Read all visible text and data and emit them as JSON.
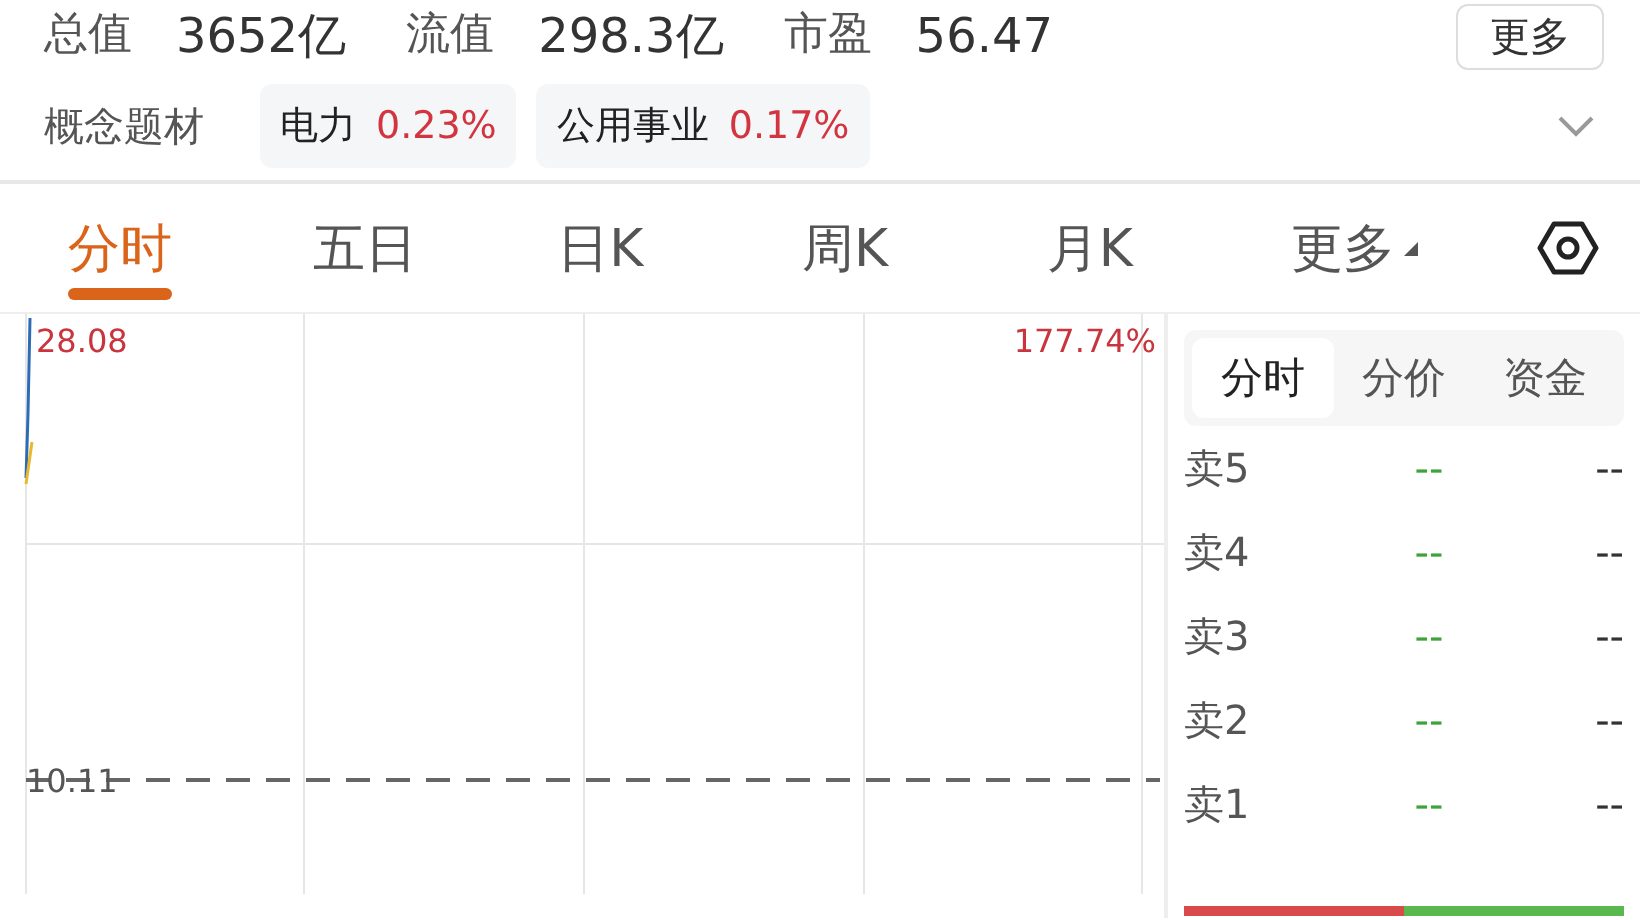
{
  "stats": [
    {
      "label": "总值",
      "value": "3652亿"
    },
    {
      "label": "流值",
      "value": "298.3亿"
    },
    {
      "label": "市盈",
      "value": "56.47"
    }
  ],
  "more_button": "更多",
  "concepts": {
    "label": "概念题材",
    "tags": [
      {
        "name": "电力",
        "change": "0.23%"
      },
      {
        "name": "公用事业",
        "change": "0.17%"
      }
    ]
  },
  "tabs": [
    {
      "label": "分时",
      "selected": true
    },
    {
      "label": "五日",
      "selected": false
    },
    {
      "label": "日K",
      "selected": false
    },
    {
      "label": "周K",
      "selected": false
    },
    {
      "label": "月K",
      "selected": false
    },
    {
      "label": "更多",
      "selected": false,
      "kind": "dropdown"
    }
  ],
  "chart": {
    "high_label": "28.08",
    "pct_label": "177.74%",
    "ref_label": "10.11"
  },
  "side_tabs": [
    {
      "label": "分时",
      "selected": true
    },
    {
      "label": "分价",
      "selected": false
    },
    {
      "label": "资金",
      "selected": false
    }
  ],
  "order_book": [
    {
      "label": "卖5",
      "price": "--",
      "volume": "--"
    },
    {
      "label": "卖4",
      "price": "--",
      "volume": "--"
    },
    {
      "label": "卖3",
      "price": "--",
      "volume": "--"
    },
    {
      "label": "卖2",
      "price": "--",
      "volume": "--"
    },
    {
      "label": "卖1",
      "price": "--",
      "volume": "--"
    }
  ],
  "buy_sell_ratio": {
    "level": 0.5
  }
}
